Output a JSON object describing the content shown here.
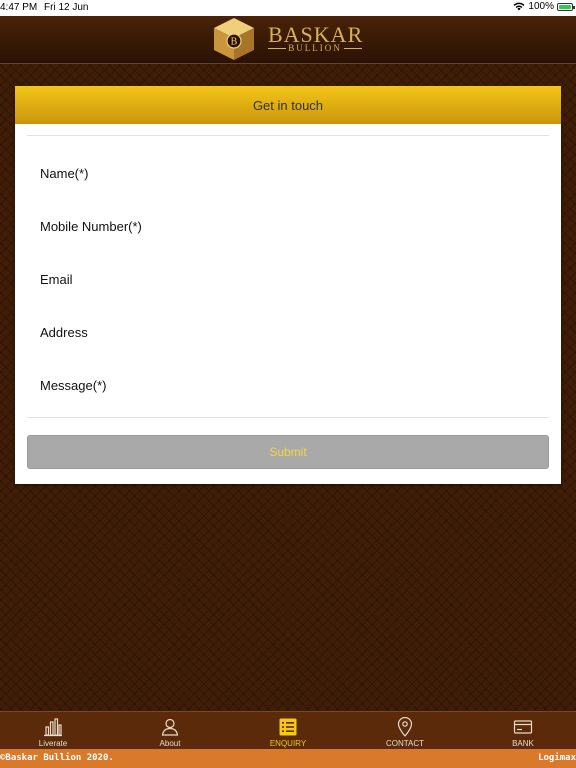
{
  "status_bar": {
    "time": "4:47 PM",
    "date": "Fri 12 Jun",
    "battery": "100%"
  },
  "header": {
    "brand": "BASKAR",
    "brand_sub": "BULLION",
    "logo_letter": "B"
  },
  "form": {
    "title": "Get in touch",
    "fields": {
      "name": "Name(*)",
      "mobile": "Mobile Number(*)",
      "email": "Email",
      "address": "Address",
      "message": "Message(*)"
    },
    "submit_label": "Submit"
  },
  "tabs": [
    {
      "label": "Liverate",
      "icon": "bar-chart-icon"
    },
    {
      "label": "About",
      "icon": "user-icon"
    },
    {
      "label": "ENQUIRY",
      "icon": "list-icon"
    },
    {
      "label": "CONTACT",
      "icon": "location-pin-icon"
    },
    {
      "label": "BANK",
      "icon": "bank-card-icon"
    }
  ],
  "colors": {
    "accent": "#f6c913",
    "tab_bar": "#5a2a0a",
    "footer": "#d97a2a",
    "submit_disabled": "#a9a9a9"
  },
  "footer": {
    "copyright": "©Baskar Bullion 2020.",
    "credit": "Logimax"
  }
}
